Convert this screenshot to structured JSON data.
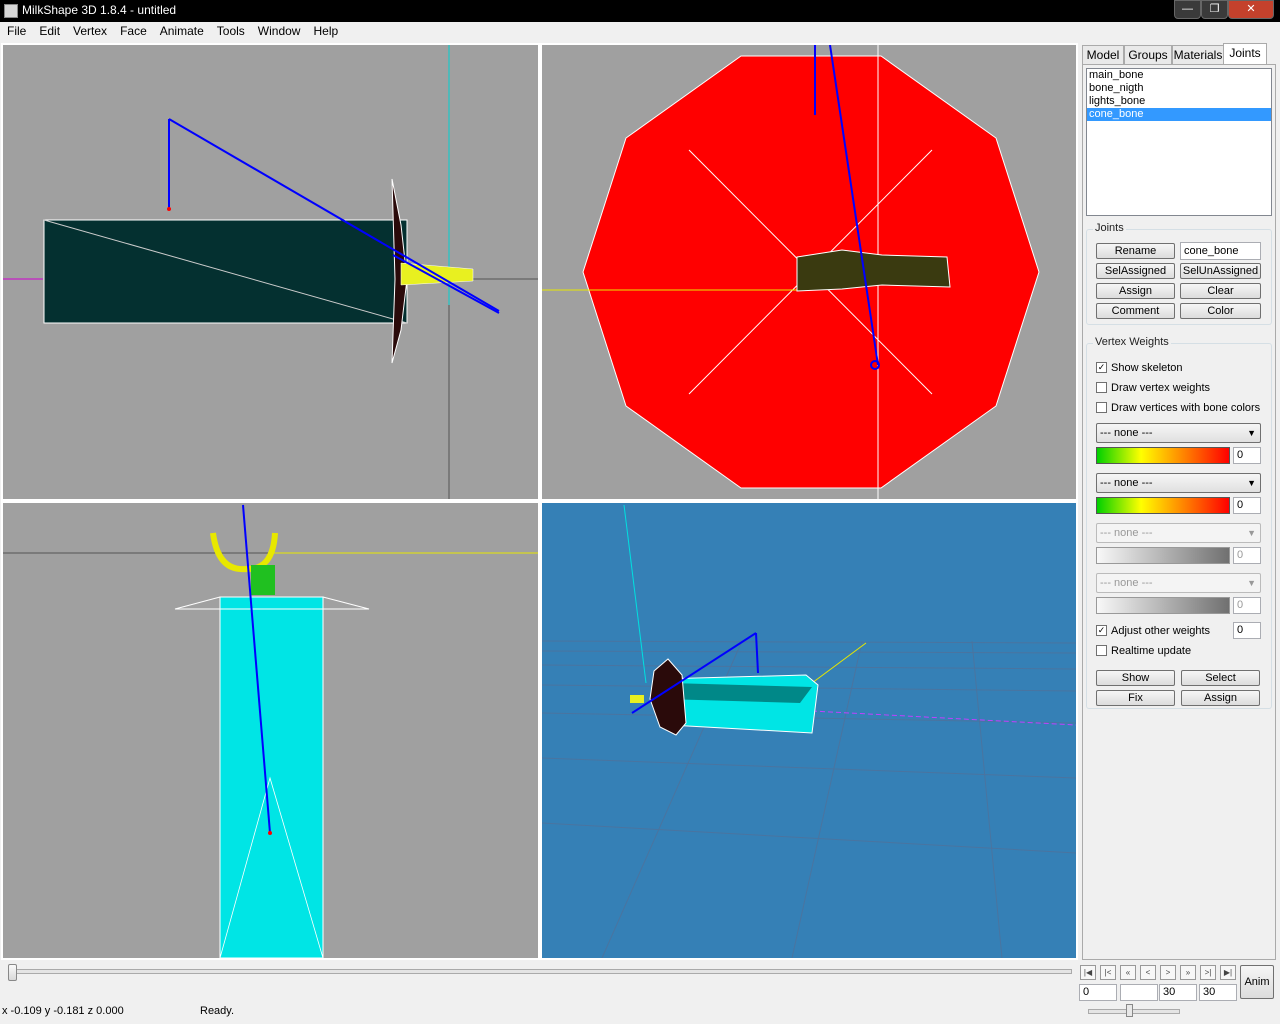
{
  "window": {
    "title": "MilkShape 3D 1.8.4 - untitled"
  },
  "menu": [
    "File",
    "Edit",
    "Vertex",
    "Face",
    "Animate",
    "Tools",
    "Window",
    "Help"
  ],
  "tabs": [
    {
      "label": "Model",
      "active": false
    },
    {
      "label": "Groups",
      "active": false
    },
    {
      "label": "Materials",
      "active": false
    },
    {
      "label": "Joints",
      "active": true
    }
  ],
  "joints": {
    "list": [
      "main_bone",
      "bone_nigth",
      "lights_bone",
      "cone_bone"
    ],
    "selected": "cone_bone",
    "group_title": "Joints",
    "rename_label": "Rename",
    "name_value": "cone_bone",
    "selassigned_label": "SelAssigned",
    "selunassigned_label": "SelUnAssigned",
    "assign_label": "Assign",
    "clear_label": "Clear",
    "comment_label": "Comment",
    "color_label": "Color"
  },
  "vertex_weights": {
    "group_title": "Vertex Weights",
    "show_skeleton": {
      "label": "Show skeleton",
      "checked": true
    },
    "draw_vertex_weights": {
      "label": "Draw vertex weights",
      "checked": false
    },
    "draw_vertices_bone_colors": {
      "label": "Draw vertices with bone colors",
      "checked": false
    },
    "bones": [
      {
        "select": "--- none ---",
        "weight": "0",
        "enabled": true
      },
      {
        "select": "--- none ---",
        "weight": "0",
        "enabled": true
      },
      {
        "select": "--- none ---",
        "weight": "0",
        "enabled": false
      },
      {
        "select": "--- none ---",
        "weight": "0",
        "enabled": false
      }
    ],
    "adjust_other_weights": {
      "label": "Adjust other weights",
      "checked": true,
      "value": "0"
    },
    "realtime_update": {
      "label": "Realtime update",
      "checked": false
    },
    "show_label": "Show",
    "select_label": "Select",
    "fix_label": "Fix",
    "assign_label": "Assign"
  },
  "timeline": {
    "frame_start": "0",
    "frame_current": "",
    "frame_value": "30",
    "frame_total": "30",
    "anim_label": "Anim",
    "slider_position": 0
  },
  "status": {
    "coords": "x -0.109 y -0.181 z 0.000",
    "message": "Ready."
  },
  "colors": {
    "viewport_bg": "#a0a0a0",
    "persp_bg": "#3580b6",
    "red_poly": "#ff0000",
    "cyan_poly": "#00e5e5",
    "dark_teal": "#043030",
    "bone_blue": "#0000ff",
    "selection_blue": "#3399ff"
  }
}
